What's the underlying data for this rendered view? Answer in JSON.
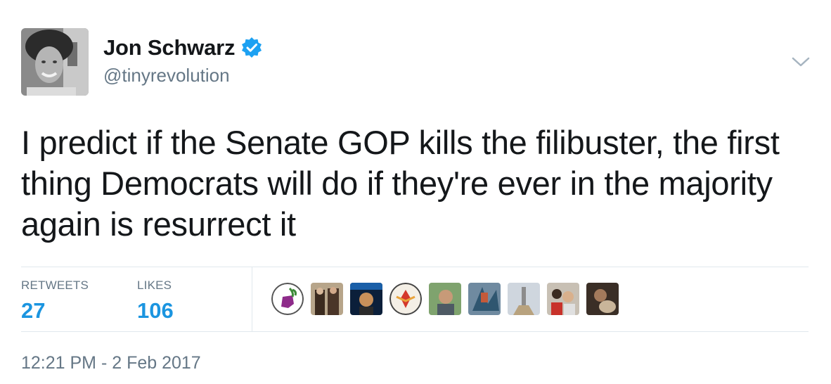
{
  "author": {
    "display_name": "Jon Schwarz",
    "handle": "@tinyrevolution",
    "verified": true,
    "avatar_icon": "profile-photo"
  },
  "tweet": {
    "text": "I predict if the Senate GOP kills the filibuster, the first thing Democrats will do if they're ever in the majority again is resurrect it"
  },
  "stats": {
    "retweets_label": "RETWEETS",
    "retweets_value": "27",
    "likes_label": "LIKES",
    "likes_value": "106"
  },
  "timestamp": "12:21 PM - 2 Feb 2017",
  "colors": {
    "accent": "#1b95e0",
    "verified": "#1da1f2",
    "secondary_text": "#657786",
    "divider": "#e1e8ed"
  },
  "icons": {
    "verified": "verified-badge-icon",
    "menu": "chevron-down-icon"
  }
}
